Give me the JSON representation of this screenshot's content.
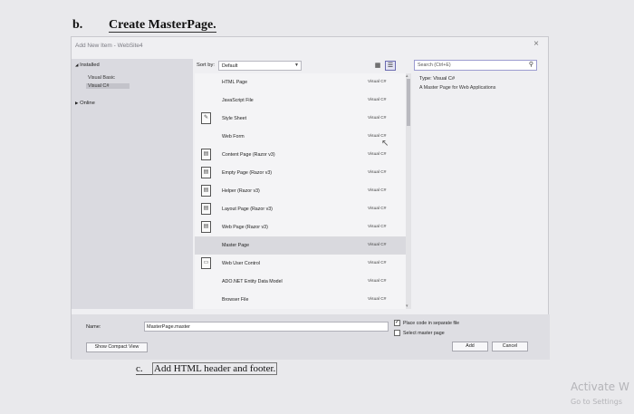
{
  "document": {
    "section_number": "b.",
    "section_title": "Create MasterPage.",
    "next_section_number": "c.",
    "next_section_title": "Add HTML header and footer."
  },
  "dialog": {
    "title": "Add New Item - WebSite4",
    "close_glyph": "×",
    "tree": {
      "installed": "Installed",
      "installed_arrow": "◢",
      "languages": [
        "Visual Basic",
        "Visual C#"
      ],
      "online": "Online",
      "online_arrow": "▶"
    },
    "sort": {
      "label": "Sort by:",
      "value": "Default",
      "arrow": "▼"
    },
    "view_icons": [
      "grid-view-icon",
      "list-view-icon"
    ],
    "search": {
      "placeholder": "Search (Ctrl+E)",
      "icon": "search-icon"
    },
    "templates": [
      {
        "name": "HTML Page",
        "lang": "Visual C#",
        "icon": ""
      },
      {
        "name": "JavaScript File",
        "lang": "Visual C#",
        "icon": ""
      },
      {
        "name": "Style Sheet",
        "lang": "Visual C#",
        "icon": "style-sheet-icon"
      },
      {
        "name": "Web Form",
        "lang": "Visual C#",
        "icon": ""
      },
      {
        "name": "Content Page (Razor v3)",
        "lang": "Visual C#",
        "icon": "razor-page-icon"
      },
      {
        "name": "Empty Page (Razor v3)",
        "lang": "Visual C#",
        "icon": "razor-page-icon"
      },
      {
        "name": "Helper (Razor v3)",
        "lang": "Visual C#",
        "icon": "razor-page-icon"
      },
      {
        "name": "Layout Page (Razor v3)",
        "lang": "Visual C#",
        "icon": "razor-page-icon"
      },
      {
        "name": "Web Page (Razor v3)",
        "lang": "Visual C#",
        "icon": "razor-page-icon"
      },
      {
        "name": "Master Page",
        "lang": "Visual C#",
        "icon": ""
      },
      {
        "name": "Web User Control",
        "lang": "Visual C#",
        "icon": "user-control-icon"
      },
      {
        "name": "ADO.NET Entity Data Model",
        "lang": "Visual C#",
        "icon": ""
      },
      {
        "name": "Browser File",
        "lang": "Visual C#",
        "icon": ""
      }
    ],
    "selected_index": 9,
    "details": {
      "type": "Type:  Visual C#",
      "description": "A Master Page for Web Applications"
    },
    "name_field": {
      "label": "Name:",
      "value": "MasterPage.master"
    },
    "checkboxes": [
      {
        "label": "Place code in separate file",
        "checked": true
      },
      {
        "label": "Select master page",
        "checked": false
      }
    ],
    "buttons": {
      "show_compact_view": "Show Compact View",
      "add": "Add",
      "cancel": "Cancel"
    }
  },
  "watermark": {
    "line1": "Activate W",
    "line2": "Go to Settings"
  }
}
